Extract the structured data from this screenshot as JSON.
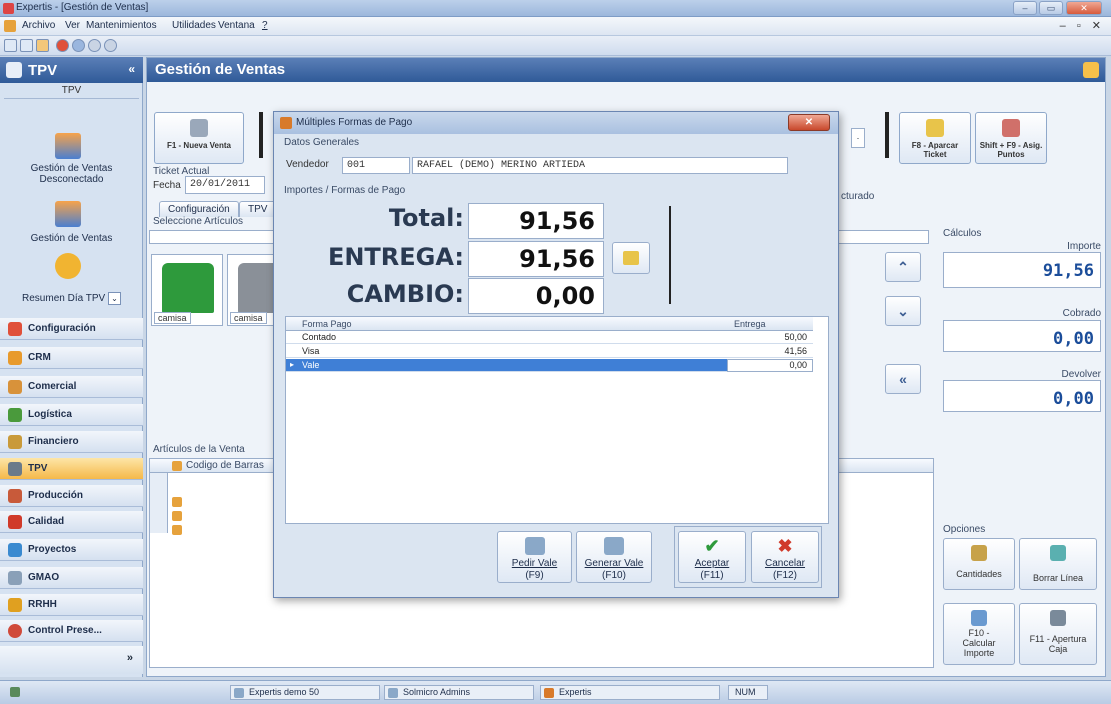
{
  "window": {
    "title": "Expertis - [Gestión de Ventas]"
  },
  "menu": [
    "Archivo",
    "Ver",
    "Mantenimientos",
    "Utilidades",
    "Ventana",
    "?"
  ],
  "leftnav": {
    "header": "TPV",
    "sub": "TPV",
    "tiles": [
      "Gestión de Ventas Desconectado",
      "Gestión de Ventas",
      "Resumen Día TPV"
    ],
    "sections": [
      "Configuración",
      "CRM",
      "Comercial",
      "Logística",
      "Financiero",
      "TPV",
      "Producción",
      "Calidad",
      "Proyectos",
      "GMAO",
      "RRHH",
      "Control Prese..."
    ]
  },
  "main": {
    "title": "Gestión de Ventas",
    "btn_nueva": "F1 - Nueva Venta",
    "btn_aparcar": "F8 - Aparcar Ticket",
    "btn_asig": "Shift + F9 - Asig. Puntos",
    "ticket_actual": "Ticket Actual",
    "fecha_label": "Fecha",
    "fecha_value": "20/01/2011",
    "facturado": "cturado",
    "tab_config": "Configuración",
    "tab_tpv": "TPV",
    "seleccione": "Seleccione Artículos",
    "product1": "camisa",
    "product2": "camisa",
    "articulos_venta": "Artículos de la Venta",
    "codigo_barras": "Codigo de Barras",
    "calculos": "Cálculos",
    "importe_label": "Importe",
    "importe_value": "91,56",
    "cobrado_label": "Cobrado",
    "cobrado_value": "0,00",
    "devolver_label": "Devolver",
    "devolver_value": "0,00",
    "opciones": "Opciones",
    "opt_cantidades": "Cantidades",
    "opt_borrar": "Borrar Línea",
    "opt_calcular": "F10 - Calcular Importe",
    "opt_apertura": "F11 - Apertura Caja"
  },
  "modal": {
    "title": "Múltiples Formas de Pago",
    "datos_generales": "Datos Generales",
    "vendedor_label": "Vendedor",
    "vendedor_code": "001",
    "vendedor_name": "RAFAEL (DEMO) MERINO ARTIEDA",
    "importes_title": "Importes / Formas de Pago",
    "total_label": "Total:",
    "total_value": "91,56",
    "entrega_label": "ENTREGA:",
    "entrega_value": "91,56",
    "cambio_label": "CAMBIO:",
    "cambio_value": "0,00",
    "grid_headers": [
      "Forma Pago",
      "Entrega"
    ],
    "grid_rows": [
      {
        "forma": "Contado",
        "entrega": "50,00"
      },
      {
        "forma": "Visa",
        "entrega": "41,56"
      },
      {
        "forma": "Vale",
        "entrega": "0,00"
      }
    ],
    "btn_pedir": "Pedir Vale",
    "btn_pedir_key": "(F9)",
    "btn_generar": "Generar Vale",
    "btn_generar_key": "(F10)",
    "btn_aceptar": "Aceptar",
    "btn_aceptar_key": "(F11)",
    "btn_cancelar": "Cancelar",
    "btn_cancelar_key": "(F12)"
  },
  "status": [
    "Expertis demo 50",
    "Solmicro Admins",
    "Expertis",
    "NUM"
  ]
}
